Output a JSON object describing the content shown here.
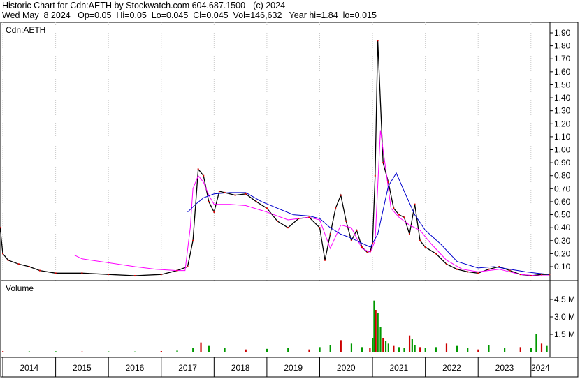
{
  "header": {
    "line1": "Historic Chart for Cdn:AETH by Stockwatch.com 604.687.1500 - (c) 2024",
    "line2": "Wed May  8 2024   Op=0.05  Hi=0.05  Lo=0.045  Cl=0.045  Vol=146,632   Year hi=1.84  lo=0.015"
  },
  "chart_data": [
    {
      "type": "line",
      "title": "Cdn:AETH",
      "ylim": [
        0,
        1.95
      ],
      "y_ticks": [
        "1.90",
        "1.80",
        "1.70",
        "1.60",
        "1.50",
        "1.40",
        "1.30",
        "1.20",
        "1.10",
        "1.00",
        "0.90",
        "0.80",
        "0.70",
        "0.60",
        "0.50",
        "0.40",
        "0.30",
        "0.20",
        "0.10"
      ],
      "x_ticks": [
        "2014",
        "2015",
        "2016",
        "2017",
        "2018",
        "2019",
        "2020",
        "2021",
        "2022",
        "2023",
        "2024"
      ],
      "series": [
        {
          "color": "#000000",
          "x": [
            2013.88,
            2013.95,
            2014.0,
            2014.1,
            2014.3,
            2014.5,
            2014.7,
            2015.0,
            2015.5,
            2016.0,
            2016.5,
            2017.0,
            2017.3,
            2017.5,
            2017.6,
            2017.7,
            2017.8,
            2017.9,
            2018.0,
            2018.1,
            2018.2,
            2018.4,
            2018.6,
            2018.8,
            2019.0,
            2019.2,
            2019.4,
            2019.6,
            2019.8,
            2020.0,
            2020.1,
            2020.2,
            2020.3,
            2020.4,
            2020.5,
            2020.6,
            2020.7,
            2020.8,
            2020.9,
            2020.96,
            2021.0,
            2021.05,
            2021.1,
            2021.2,
            2021.3,
            2021.4,
            2021.5,
            2021.6,
            2021.7,
            2021.8,
            2021.9,
            2022.0,
            2022.2,
            2022.4,
            2022.6,
            2022.8,
            2023.0,
            2023.2,
            2023.4,
            2023.6,
            2023.8,
            2024.0,
            2024.2,
            2024.35
          ],
          "values": [
            0.18,
            0.4,
            0.2,
            0.15,
            0.12,
            0.1,
            0.07,
            0.05,
            0.05,
            0.04,
            0.03,
            0.04,
            0.07,
            0.1,
            0.3,
            0.85,
            0.8,
            0.6,
            0.52,
            0.68,
            0.67,
            0.65,
            0.66,
            0.6,
            0.55,
            0.45,
            0.4,
            0.47,
            0.48,
            0.4,
            0.15,
            0.35,
            0.55,
            0.65,
            0.45,
            0.3,
            0.38,
            0.25,
            0.21,
            0.22,
            0.28,
            0.8,
            1.84,
            0.9,
            0.75,
            0.55,
            0.5,
            0.48,
            0.35,
            0.58,
            0.3,
            0.25,
            0.2,
            0.12,
            0.08,
            0.06,
            0.05,
            0.08,
            0.1,
            0.07,
            0.04,
            0.03,
            0.04,
            0.04
          ]
        },
        {
          "color": "#ff00ff",
          "x": [
            2015.35,
            2015.5,
            2016.0,
            2016.5,
            2016.9,
            2017.3,
            2017.45,
            2017.55,
            2017.6,
            2017.7,
            2017.8,
            2017.9,
            2018.0,
            2018.3,
            2018.6,
            2019.0,
            2019.4,
            2019.8,
            2020.0,
            2020.2,
            2020.4,
            2020.6,
            2020.8,
            2020.96,
            2021.05,
            2021.15,
            2021.25,
            2021.35,
            2021.5,
            2021.7,
            2021.9,
            2022.1,
            2022.4,
            2022.7,
            2023.0,
            2023.4,
            2023.8,
            2024.1,
            2024.35
          ],
          "values": [
            0.19,
            0.16,
            0.13,
            0.1,
            0.08,
            0.07,
            0.07,
            0.4,
            0.7,
            0.8,
            0.75,
            0.65,
            0.58,
            0.58,
            0.57,
            0.52,
            0.46,
            0.48,
            0.46,
            0.24,
            0.42,
            0.4,
            0.24,
            0.21,
            0.3,
            1.15,
            0.85,
            0.55,
            0.48,
            0.42,
            0.38,
            0.28,
            0.15,
            0.08,
            0.06,
            0.08,
            0.04,
            0.03,
            0.03
          ]
        },
        {
          "color": "#0000cc",
          "x": [
            2017.5,
            2017.65,
            2017.8,
            2018.0,
            2018.3,
            2018.6,
            2018.9,
            2019.2,
            2019.5,
            2019.8,
            2020.0,
            2020.2,
            2020.4,
            2020.6,
            2020.8,
            2020.96,
            2021.1,
            2021.3,
            2021.45,
            2021.6,
            2021.8,
            2022.0,
            2022.3,
            2022.6,
            2023.0,
            2023.3,
            2023.6,
            2023.9,
            2024.1,
            2024.35
          ],
          "values": [
            0.52,
            0.58,
            0.63,
            0.66,
            0.67,
            0.67,
            0.6,
            0.55,
            0.5,
            0.49,
            0.47,
            0.4,
            0.35,
            0.32,
            0.28,
            0.25,
            0.35,
            0.72,
            0.82,
            0.68,
            0.5,
            0.38,
            0.27,
            0.14,
            0.09,
            0.1,
            0.08,
            0.06,
            0.05,
            0.04
          ]
        }
      ]
    },
    {
      "type": "bar",
      "title": "Volume",
      "ylim": [
        0,
        5400000
      ],
      "y_ticks": [
        "4.5 M",
        "3.0 M",
        "1.5 M"
      ],
      "x": [
        2014.0,
        2014.5,
        2015.0,
        2015.5,
        2016.0,
        2016.5,
        2017.0,
        2017.3,
        2017.6,
        2017.75,
        2017.9,
        2018.2,
        2018.6,
        2019.0,
        2019.4,
        2019.8,
        2020.0,
        2020.2,
        2020.4,
        2020.6,
        2020.8,
        2020.95,
        2021.0,
        2021.03,
        2021.06,
        2021.1,
        2021.15,
        2021.2,
        2021.25,
        2021.3,
        2021.4,
        2021.5,
        2021.6,
        2021.7,
        2021.75,
        2021.8,
        2021.9,
        2022.0,
        2022.2,
        2022.4,
        2022.6,
        2022.8,
        2023.0,
        2023.2,
        2023.5,
        2023.8,
        2024.0,
        2024.1,
        2024.2,
        2024.3
      ],
      "values": [
        50000,
        30000,
        40000,
        20000,
        30000,
        20000,
        60000,
        100000,
        300000,
        800000,
        500000,
        300000,
        200000,
        250000,
        300000,
        200000,
        400000,
        600000,
        1000000,
        700000,
        400000,
        300000,
        1200000,
        4400000,
        3600000,
        3300000,
        2100000,
        1200000,
        900000,
        700000,
        500000,
        400000,
        300000,
        1400000,
        1100000,
        600000,
        400000,
        300000,
        400000,
        700000,
        500000,
        300000,
        200000,
        600000,
        300000,
        400000,
        300000,
        1500000,
        700000,
        500000
      ]
    }
  ]
}
